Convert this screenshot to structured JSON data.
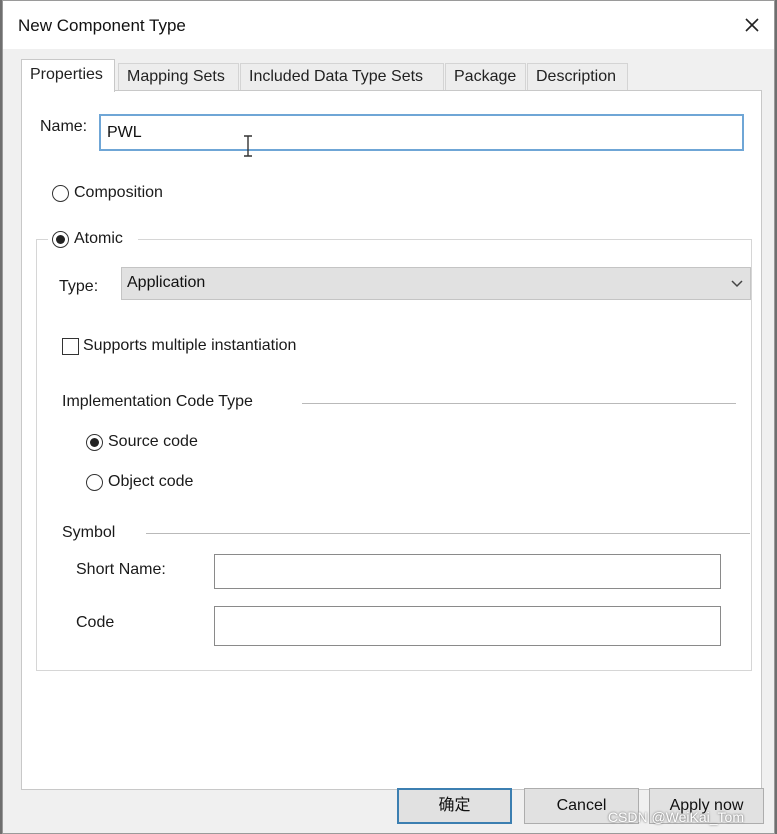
{
  "window": {
    "title": "New Component Type",
    "close_icon": "close-icon"
  },
  "tabs": [
    {
      "label": "Properties",
      "active": true
    },
    {
      "label": "Mapping Sets",
      "active": false
    },
    {
      "label": "Included Data Type Sets",
      "active": false
    },
    {
      "label": "Package",
      "active": false
    },
    {
      "label": "Description",
      "active": false
    }
  ],
  "properties": {
    "name_label": "Name:",
    "name_value": "PWL",
    "composition_label": "Composition",
    "atomic_label": "Atomic",
    "kind_selected": "Atomic",
    "type_label": "Type:",
    "type_value": "Application",
    "multiple_instantiation_label": "Supports multiple instantiation",
    "multiple_instantiation_checked": false,
    "impl_code_type_label": "Implementation Code Type",
    "source_code_label": "Source code",
    "object_code_label": "Object code",
    "impl_selected": "Source code",
    "symbol_label": "Symbol",
    "short_name_label": "Short Name:",
    "short_name_value": "",
    "code_label": "Code",
    "code_value": ""
  },
  "buttons": {
    "ok_label": "确定",
    "cancel_label": "Cancel",
    "apply_label": "Apply now"
  },
  "watermark": "CSDN @WeiKai_Tom",
  "colors": {
    "focus_border": "#6fa6d6",
    "default_button_border": "#3c7fb1",
    "dialog_background": "#f0f0f0"
  }
}
